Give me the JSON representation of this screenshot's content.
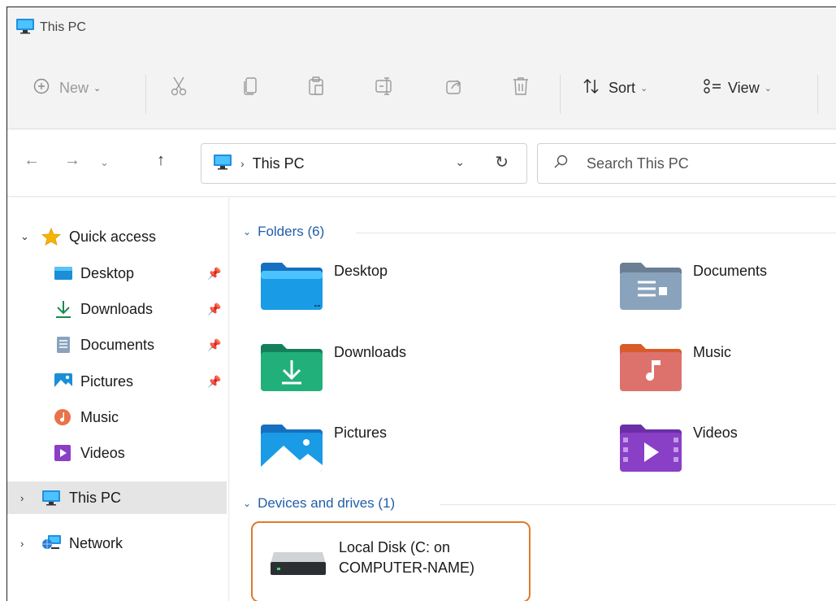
{
  "window": {
    "title": "This PC"
  },
  "toolbar": {
    "new_label": "New",
    "sort_label": "Sort",
    "view_label": "View"
  },
  "address": {
    "crumb": "This PC",
    "search_placeholder": "Search This PC"
  },
  "nav": {
    "quick_access": "Quick access",
    "items": [
      {
        "label": "Desktop",
        "pinned": true
      },
      {
        "label": "Downloads",
        "pinned": true
      },
      {
        "label": "Documents",
        "pinned": true
      },
      {
        "label": "Pictures",
        "pinned": true
      },
      {
        "label": "Music",
        "pinned": false
      },
      {
        "label": "Videos",
        "pinned": false
      }
    ],
    "this_pc": "This PC",
    "network": "Network"
  },
  "content": {
    "folders_header": "Folders (6)",
    "folders": [
      {
        "name": "Desktop"
      },
      {
        "name": "Documents"
      },
      {
        "name": "Downloads"
      },
      {
        "name": "Music"
      },
      {
        "name": "Pictures"
      },
      {
        "name": "Videos"
      }
    ],
    "drives_header": "Devices and drives (1)",
    "drive": {
      "name_line1": "Local Disk (C: on",
      "name_line2": "COMPUTER-NAME)"
    }
  },
  "colors": {
    "highlight_border": "#e07a2e",
    "group_header": "#1f5fa8",
    "accent": "#0078d4"
  }
}
